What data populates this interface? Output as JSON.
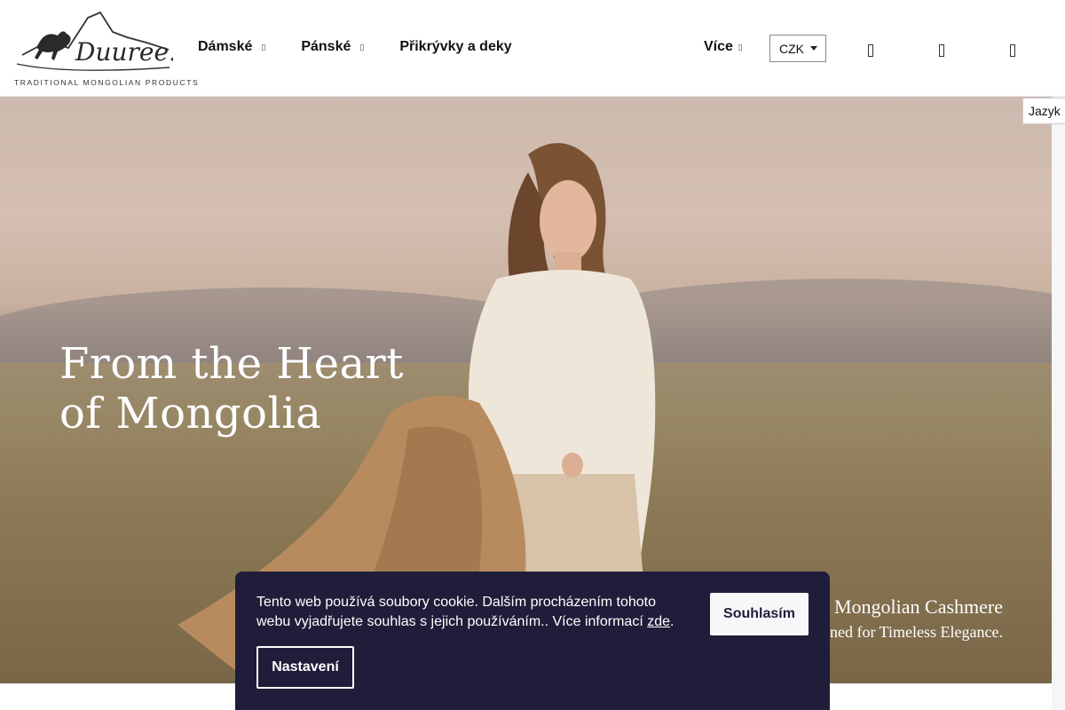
{
  "brand": {
    "logo_text": "Duuree.cz",
    "tagline": "TRADITIONAL MONGOLIAN PRODUCTS"
  },
  "nav": {
    "items": [
      {
        "label": "Dámské",
        "has_dropdown": true
      },
      {
        "label": "Pánské",
        "has_dropdown": true
      },
      {
        "label": "Přikrývky a deky",
        "has_dropdown": false
      }
    ],
    "more_label": "Více",
    "chevron": "▾"
  },
  "currency": {
    "selected": "CZK"
  },
  "header_icons": [
    "search-icon",
    "user-icon",
    "cart-icon"
  ],
  "language_tab": {
    "label": "Jazyk"
  },
  "hero": {
    "title_line1": "From the Heart",
    "title_line2": "of Mongolia",
    "subtitle_line1": "Mongolian Cashmere",
    "subtitle_line2": "gned for Timeless Elegance."
  },
  "cookie_bar": {
    "text": "Tento web používá soubory cookie. Dalším procházením tohoto webu vyjadřujete souhlas s jejich používáním.. Více informací ",
    "link_label": "zde",
    "after_link": ".",
    "agree_label": "Souhlasím",
    "settings_label": "Nastavení"
  },
  "colors": {
    "cookie_bg": "#1f1d3a",
    "header_bg": "#ffffff",
    "text": "#111111"
  }
}
